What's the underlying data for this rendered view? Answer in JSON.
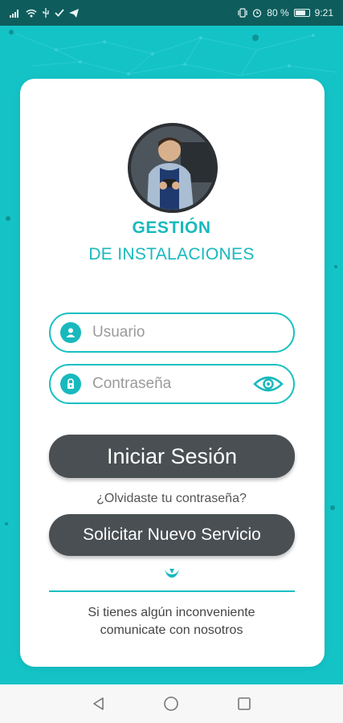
{
  "status_bar": {
    "battery_percent": "80 %",
    "time": "9:21"
  },
  "app": {
    "title_line1": "GESTIÓN",
    "title_line2": "DE INSTALACIONES"
  },
  "login": {
    "username_placeholder": "Usuario",
    "password_placeholder": "Contraseña",
    "login_button": "Iniciar Sesión",
    "forgot_password": "¿Olvidaste tu contraseña?",
    "request_service_button": "Solicitar Nuevo Servicio"
  },
  "footer": {
    "contact_line1": "Si tienes algún inconveniente",
    "contact_line2": "comunicate con nosotros"
  },
  "colors": {
    "accent": "#18b9bd",
    "background": "#14c3c6",
    "button": "#4a4f53",
    "status_bar": "#0e5d5c"
  },
  "icons": {
    "user_field": "user-icon",
    "password_field": "lock-icon",
    "toggle_password": "eye-icon"
  }
}
